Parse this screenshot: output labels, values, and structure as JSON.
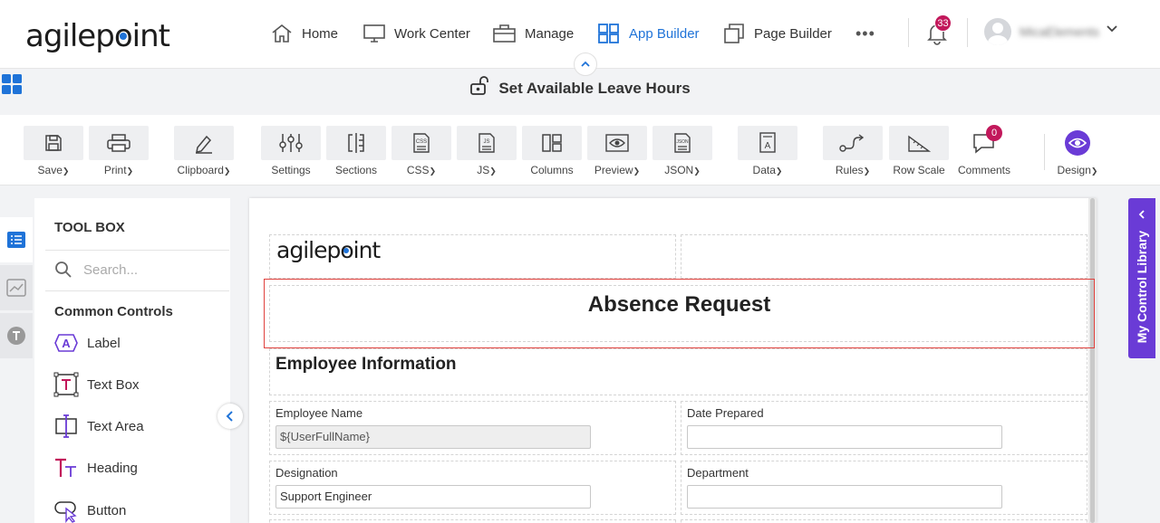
{
  "brand": {
    "logo_text": "agilepoint",
    "accent": "#1f73d8",
    "highlight": "#e0413d",
    "library_color": "#6a3bd6"
  },
  "nav": {
    "items": [
      {
        "label": "Home",
        "icon": "home-icon"
      },
      {
        "label": "Work Center",
        "icon": "monitor-icon"
      },
      {
        "label": "Manage",
        "icon": "briefcase-icon"
      },
      {
        "label": "App Builder",
        "icon": "grid-icon",
        "active": true
      },
      {
        "label": "Page Builder",
        "icon": "pages-icon"
      }
    ],
    "more": "•••",
    "notifications_count": "33",
    "username": "MicaElements"
  },
  "page": {
    "title": "Set Available Leave Hours"
  },
  "toolbar": {
    "tools": [
      {
        "label": "Save",
        "icon": "save-icon",
        "dropdown": true
      },
      {
        "label": "Print",
        "icon": "print-icon",
        "dropdown": true
      },
      {
        "label": "Clipboard",
        "icon": "pencil-icon",
        "dropdown": true
      },
      {
        "label": "Settings",
        "icon": "sliders-icon",
        "dropdown": false
      },
      {
        "label": "Sections",
        "icon": "sections-icon",
        "dropdown": false
      },
      {
        "label": "CSS",
        "icon": "css-file-icon",
        "dropdown": true
      },
      {
        "label": "JS",
        "icon": "js-file-icon",
        "dropdown": true
      },
      {
        "label": "Columns",
        "icon": "columns-icon",
        "dropdown": false
      },
      {
        "label": "Preview",
        "icon": "eye-icon",
        "dropdown": true
      },
      {
        "label": "JSON",
        "icon": "json-file-icon",
        "dropdown": true
      },
      {
        "label": "Data",
        "icon": "data-book-icon",
        "dropdown": true
      },
      {
        "label": "Rules",
        "icon": "rules-icon",
        "dropdown": true
      },
      {
        "label": "Row Scale",
        "icon": "ruler-icon",
        "dropdown": false
      },
      {
        "label": "Comments",
        "icon": "comment-icon",
        "dropdown": false
      },
      {
        "label": "Design",
        "icon": "design-eye-icon",
        "dropdown": true
      }
    ],
    "comments_count": "0"
  },
  "toolbox": {
    "title": "TOOL BOX",
    "search_placeholder": "Search...",
    "section": "Common Controls",
    "items": [
      {
        "label": "Label",
        "icon": "label-a-icon"
      },
      {
        "label": "Text Box",
        "icon": "textbox-t-icon"
      },
      {
        "label": "Text Area",
        "icon": "textarea-icon"
      },
      {
        "label": "Heading",
        "icon": "heading-tt-icon"
      },
      {
        "label": "Button",
        "icon": "button-cursor-icon"
      }
    ]
  },
  "form": {
    "logo_text": "agilepoint",
    "title": "Absence Request",
    "section": "Employee Information",
    "fields": [
      {
        "label": "Employee Name",
        "value": "${UserFullName}",
        "readonly": true
      },
      {
        "label": "Date Prepared",
        "value": ""
      },
      {
        "label": "Designation",
        "value": "Support Engineer"
      },
      {
        "label": "Department",
        "value": ""
      }
    ]
  },
  "control_library": {
    "label": "My Control Library"
  }
}
